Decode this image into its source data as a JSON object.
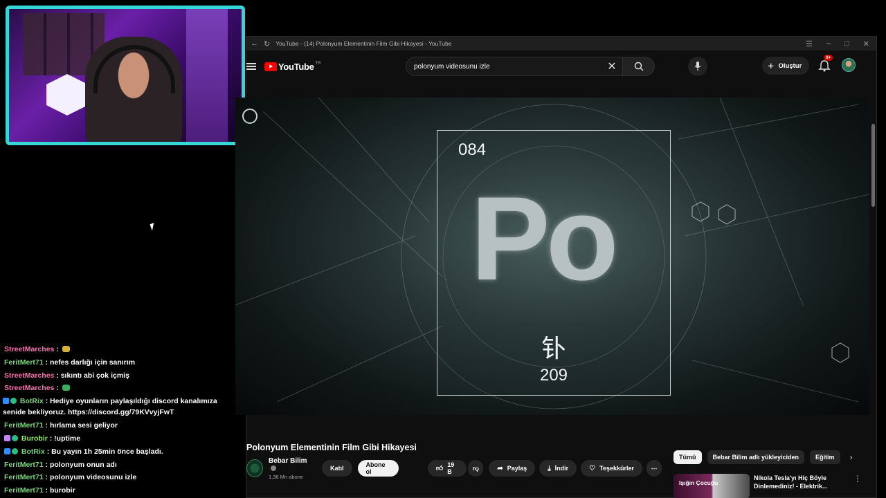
{
  "chat": [
    {
      "user": "StreetMarches",
      "color": "pink",
      "text": ":",
      "emote": "yellow"
    },
    {
      "user": "FeritMert71",
      "color": "green",
      "text": ": nefes darlığı için sanırım"
    },
    {
      "user": "StreetMarches",
      "color": "pink",
      "text": ": sıkıntı abi çok içmiş"
    },
    {
      "user": "StreetMarches",
      "color": "pink",
      "text": ":",
      "emote": "green"
    },
    {
      "user": "BotRix",
      "color": "green",
      "badges": [
        "blue",
        "greenb"
      ],
      "text": ": Hediye oyunların paylaşıldığı discord kanalımıza senide bekliyoruz. https://discord.gg/79KVvyjFwT",
      "wrap": true
    },
    {
      "user": "FeritMert71",
      "color": "green",
      "text": ": hırlama sesi geliyor"
    },
    {
      "user": "Burobir",
      "color": "lime",
      "badges": [
        "purple",
        "greenb"
      ],
      "text": ": !uptime"
    },
    {
      "user": "BotRix",
      "color": "green",
      "badges": [
        "blue",
        "greenb"
      ],
      "text": ": Bu yayın 1h 25min önce başladı."
    },
    {
      "user": "FeritMert71",
      "color": "green",
      "text": ": polonyum onun adı"
    },
    {
      "user": "FeritMert71",
      "color": "green",
      "text": ": polonyum videosunu izle"
    },
    {
      "user": "FeritMert71",
      "color": "green",
      "text": ": burobir"
    }
  ],
  "window": {
    "title": "YouTube - (14) Polonyum Elementinin Film Gibi Hikayesi - YouTube"
  },
  "youtube": {
    "logo_text": "YouTube",
    "country": "TR",
    "search_value": "polonyum videosunu izle",
    "create_label": "Oluştur",
    "notif_count": "9+"
  },
  "video": {
    "element_number": "084",
    "element_symbol": "Po",
    "element_cjk": "钋",
    "element_mass": "209",
    "title": "Polonyum Elementinin Film Gibi Hikayesi",
    "channel_name": "Bebar Bilim",
    "subscribers": "1,36 Mn abone",
    "join_label": "Katıl",
    "subscribe_label": "Abone ol",
    "likes": "19 B",
    "share_label": "Paylaş",
    "download_label": "İndir",
    "thanks_label": "Teşekkürler"
  },
  "sidebar_chips": [
    "Tümü",
    "Bebar Bilim adlı yükleyiciden",
    "Eğitim"
  ],
  "recommendation": {
    "thumb_text": "Işığın Çocuğu",
    "title": "Nikola Tesla'yı Hiç Böyle Dinlemediniz! - Elektrik..."
  },
  "colors": {
    "webcam_border": "#35d6d6",
    "yt_red": "#ff0000",
    "background": "#0f0f0f"
  }
}
